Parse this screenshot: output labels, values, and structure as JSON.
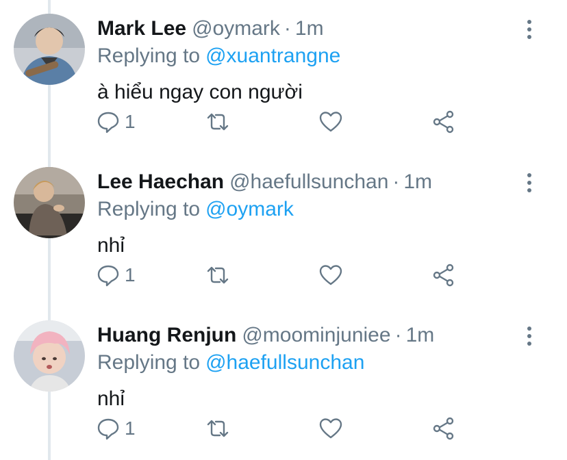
{
  "tweets": [
    {
      "name": "Mark Lee",
      "handle": "@oymark",
      "separator": "·",
      "time": "1m",
      "replying_label": "Replying to",
      "replying_to": "@xuantrangne",
      "text": "à hiểu ngay con người",
      "reply_count": "1",
      "avatar_icon": "avatar-photo"
    },
    {
      "name": "Lee Haechan",
      "handle": "@haefullsunchan",
      "separator": "·",
      "time": "1m",
      "replying_label": "Replying to",
      "replying_to": "@oymark",
      "text": "nhỉ",
      "reply_count": "1",
      "avatar_icon": "avatar-photo"
    },
    {
      "name": "Huang Renjun",
      "handle": "@moominjuniee",
      "separator": "·",
      "time": "1m",
      "replying_label": "Replying to",
      "replying_to": "@haefullsunchan",
      "text": "nhỉ",
      "reply_count": "1",
      "avatar_icon": "avatar-photo"
    }
  ],
  "colors": {
    "accent": "#1da1f2",
    "secondary_text": "#657786",
    "primary_text": "#14171a",
    "thread_line": "#e1e8ed"
  }
}
